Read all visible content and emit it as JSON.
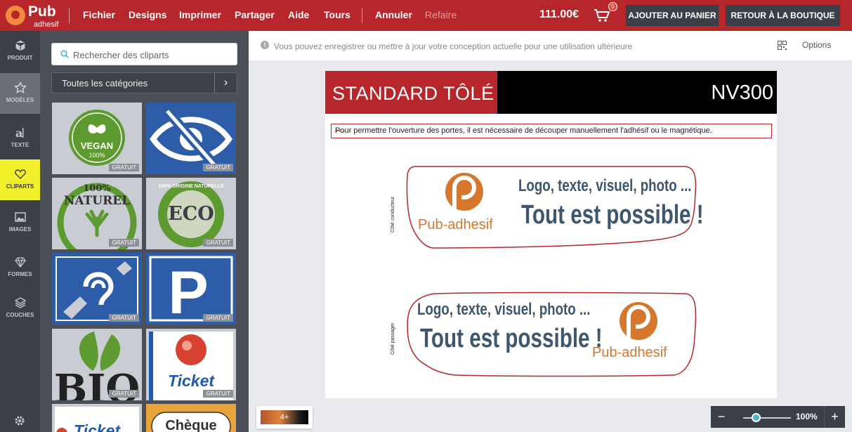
{
  "brand": {
    "logo_top": "Pub",
    "logo_bottom": "adhesif"
  },
  "menu": {
    "items": [
      "Fichier",
      "Designs",
      "Imprimer",
      "Partager",
      "Aide",
      "Tours"
    ],
    "undo": "Annuler",
    "redo": "Refaire"
  },
  "cart": {
    "price": "111.00€",
    "count": "0"
  },
  "buttons": {
    "add_to_cart": "AJOUTER AU PANIER",
    "back_to_shop": "RETOUR À LA BOUTIQUE"
  },
  "rail": [
    {
      "label": "PRODUIT",
      "icon": "cube-icon"
    },
    {
      "label": "MODÈLES",
      "icon": "star-icon"
    },
    {
      "label": "TEXTE",
      "icon": "text-icon"
    },
    {
      "label": "CLIPARTS",
      "icon": "heart-icon"
    },
    {
      "label": "IMAGES",
      "icon": "image-icon"
    },
    {
      "label": "FORMES",
      "icon": "diamond-icon"
    },
    {
      "label": "COUCHES",
      "icon": "layers-icon"
    }
  ],
  "clipart_panel": {
    "search_placeholder": "Rechercher des cliparts",
    "category": "Toutes les catégories",
    "tiles": [
      {
        "name": "vegan",
        "text": "VEGAN",
        "sub": "100%",
        "badge": "GRATUIT"
      },
      {
        "name": "hearing-eye",
        "text": "",
        "sub": "",
        "badge": "GRATUIT"
      },
      {
        "name": "naturel",
        "text": "NATUREL",
        "sub": "100%",
        "badge": "GRATUIT"
      },
      {
        "name": "eco",
        "text": "ECO",
        "sub": "100% ORIGINE NATURELLE",
        "badge": "GRATUIT"
      },
      {
        "name": "deaf",
        "text": "",
        "sub": "",
        "badge": "GRATUIT"
      },
      {
        "name": "parking",
        "text": "P",
        "sub": "",
        "badge": "GRATUIT"
      },
      {
        "name": "bio",
        "text": "BIO",
        "sub": "",
        "badge": "GRATUIT"
      },
      {
        "name": "ticket",
        "text": "Ticket",
        "sub": "",
        "badge": "GRATUIT"
      },
      {
        "name": "ticket-2",
        "text": "Ticket",
        "sub": "",
        "badge": ""
      },
      {
        "name": "cheque",
        "text": "Chèque",
        "sub": "",
        "badge": ""
      }
    ]
  },
  "info": {
    "message": "Vous pouvez enregistrer ou mettre à jour votre conception actuelle pour une utilisation ultérieure",
    "options": "Options"
  },
  "design": {
    "header_left": "STANDARD TÔLÉ",
    "header_right": "NV300",
    "notice": "Pour permettre l'ouverture des portes, il est nécessaire de découper manuellement l'adhésif ou le magnétique.",
    "side_top": "Côté conducteur",
    "side_bottom": "Côté passager",
    "line1": "Logo, texte, visuel, photo ...",
    "line2": "Tout est possible !",
    "brand": "Pub-adhesif"
  },
  "bottom": {
    "page_label": "4+",
    "zoom": "100%"
  },
  "colors": {
    "topbar": "#b7262a",
    "rail": "#3b3f47",
    "selected": "#f2ef2b",
    "accent": "#4fb6c9",
    "brand_orange": "#d5782e"
  }
}
